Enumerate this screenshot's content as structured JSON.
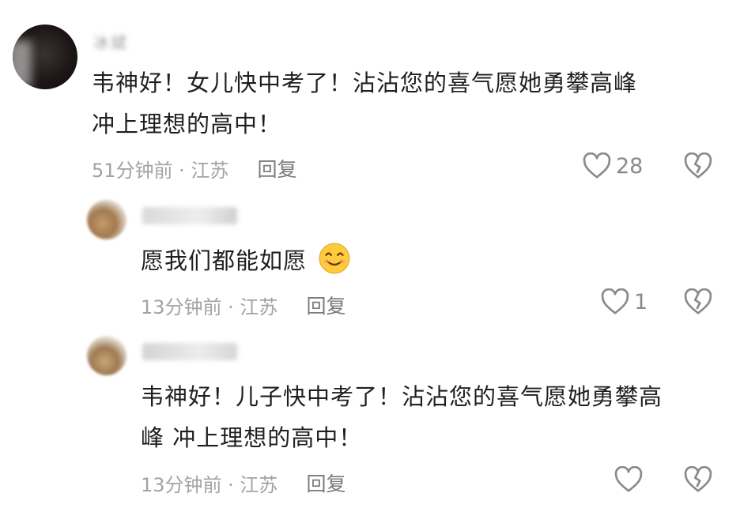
{
  "comments": [
    {
      "username": "冰斌",
      "text_line1": "韦神好！女儿快中考了！沾沾您的喜气愿她勇攀高峰",
      "text_line2": "冲上理想的高中！",
      "time_location": "51分钟前 · 江苏",
      "reply_label": "回复",
      "like_count": "28",
      "icons": {
        "like": "heart-outline-icon",
        "dislike": "broken-heart-icon"
      }
    },
    {
      "username": "",
      "text_line1": "愿我们都能如愿",
      "emoji": "smiling-face-emoji",
      "time_location": "13分钟前 · 江苏",
      "reply_label": "回复",
      "like_count": "1",
      "icons": {
        "like": "heart-outline-icon",
        "dislike": "broken-heart-icon"
      }
    },
    {
      "username": "",
      "text_line1": "韦神好！儿子快中考了！沾沾您的喜气愿她勇攀高",
      "text_line2": "峰 冲上理想的高中！",
      "time_location": "13分钟前 · 江苏",
      "reply_label": "回复",
      "like_count": "",
      "icons": {
        "like": "heart-outline-icon",
        "dislike": "broken-heart-icon"
      }
    }
  ],
  "colors": {
    "text": "#1f1f1f",
    "meta": "#a3a3a3",
    "icon": "#8a8a8a"
  }
}
